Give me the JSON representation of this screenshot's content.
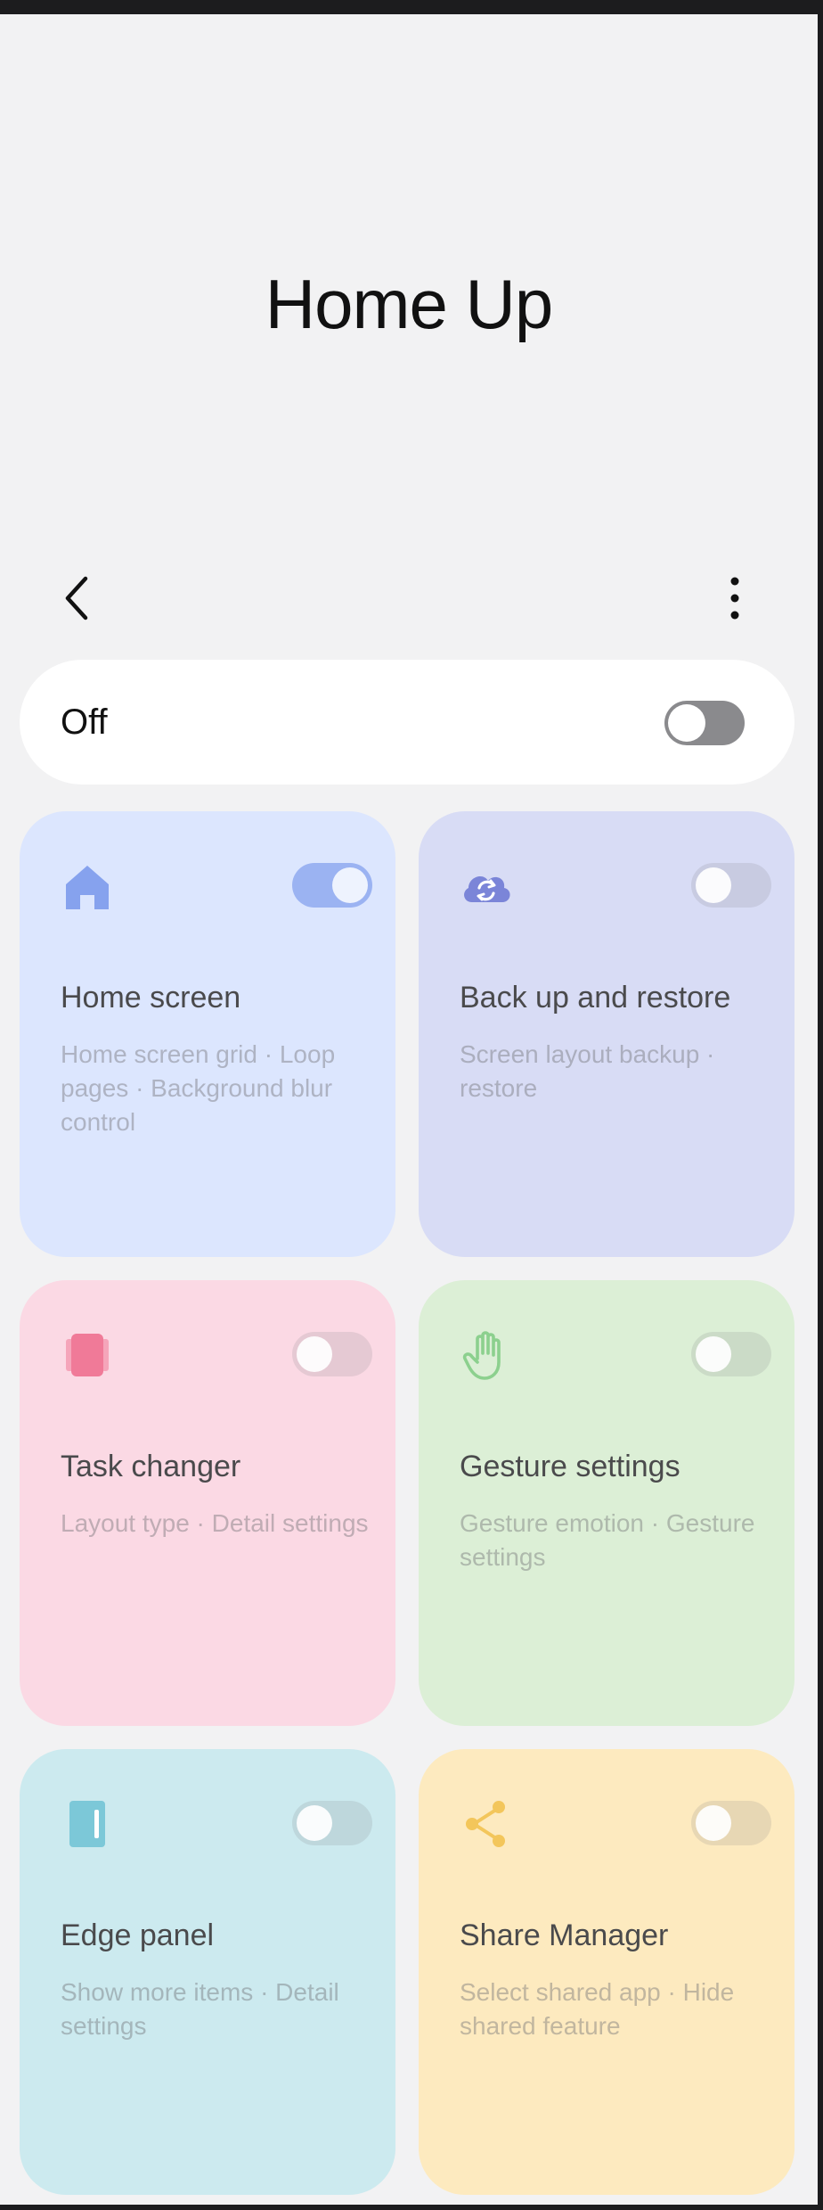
{
  "header": {
    "title": "Home Up"
  },
  "nav": {
    "back_icon": "chevron-left-icon",
    "more_icon": "more-vertical-icon"
  },
  "master_switch": {
    "label": "Off",
    "checked": false
  },
  "cards": [
    {
      "title": "Home screen",
      "subtitle": "Home screen grid · Loop pages · Background blur control",
      "icon": "home-icon",
      "toggle_on": true,
      "bg_color": "#dce6fe",
      "accent_color": "#86a2ee"
    },
    {
      "title": "Back up and restore",
      "subtitle": "Screen layout backup · restore",
      "icon": "cloud-sync-icon",
      "toggle_on": false,
      "bg_color": "#d8dcf5",
      "accent_color": "#7b85d8"
    },
    {
      "title": "Task changer",
      "subtitle": "Layout type · Detail settings",
      "icon": "task-stack-icon",
      "toggle_on": false,
      "bg_color": "#fbd9e4",
      "accent_color": "#f07a98"
    },
    {
      "title": "Gesture settings",
      "subtitle": "Gesture emotion · Gesture settings",
      "icon": "hand-icon",
      "toggle_on": false,
      "bg_color": "#dcefd6",
      "accent_color": "#8cd08e"
    },
    {
      "title": "Edge panel",
      "subtitle": "Show more items · Detail settings",
      "icon": "edge-panel-icon",
      "toggle_on": false,
      "bg_color": "#cceaef",
      "accent_color": "#7cc8d8"
    },
    {
      "title": "Share Manager",
      "subtitle": "Select shared app · Hide shared feature",
      "icon": "share-icon",
      "toggle_on": false,
      "bg_color": "#fdeabf",
      "accent_color": "#f3c65b"
    }
  ]
}
